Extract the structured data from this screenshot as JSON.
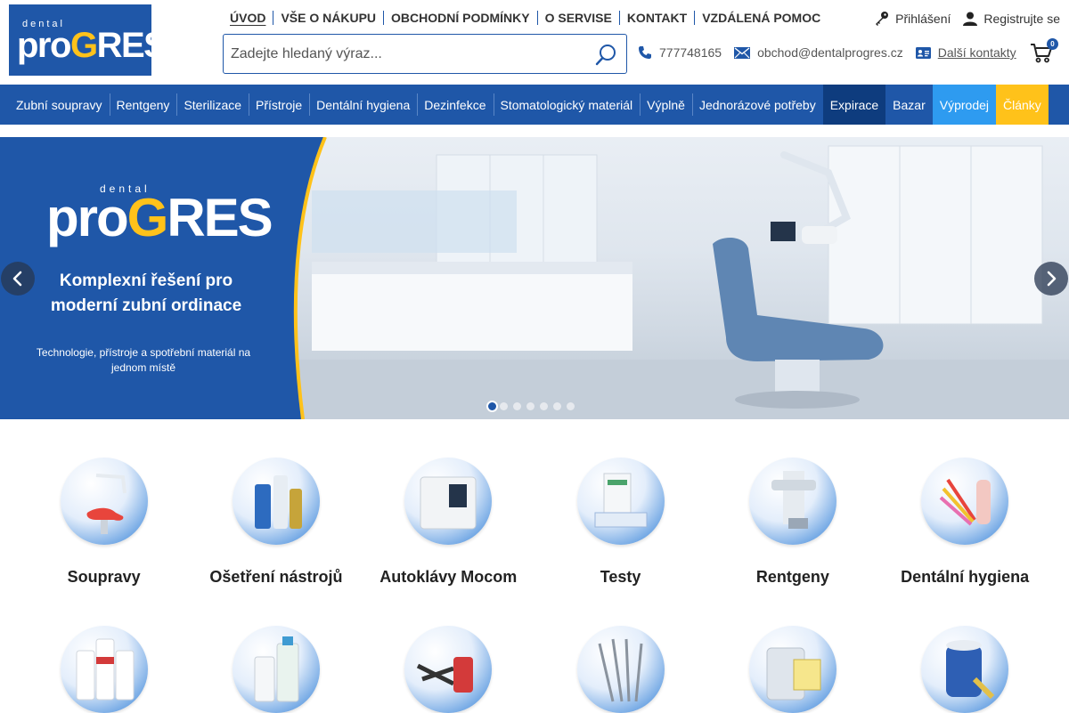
{
  "logo": {
    "small": "dental",
    "pro": "pro",
    "g": "G",
    "res": "RES"
  },
  "topnav": [
    "ÚVOD",
    "VŠE O NÁKUPU",
    "OBCHODNÍ PODMÍNKY",
    "O SERVISE",
    "KONTAKT",
    "VZDÁLENÁ POMOC"
  ],
  "account": {
    "login": "Přihlášení",
    "register": "Registrujte se"
  },
  "search": {
    "placeholder": "Zadejte hledaný výraz..."
  },
  "contacts": {
    "phone": "777748165",
    "email": "obchod@dentalprogres.cz",
    "more": "Další kontakty"
  },
  "cart": {
    "count": "0"
  },
  "categories": [
    "Zubní soupravy",
    "Rentgeny",
    "Sterilizace",
    "Přístroje",
    "Dentální hygiena",
    "Dezinfekce",
    "Stomatologický materiál",
    "Výplně",
    "Jednorázové potřeby",
    "Expirace",
    "Bazar",
    "Výprodej",
    "Články"
  ],
  "hero": {
    "logo_small": "dental",
    "logo_pro": "pro",
    "logo_g": "G",
    "logo_res": "RES",
    "title": "Komplexní řešení pro moderní zubní ordinace",
    "subtitle": "Technologie, přístroje a spotřební materiál na jednom místě",
    "slide_count": 7,
    "active_slide": 1
  },
  "tiles": [
    {
      "name": "Soupravy",
      "icon": "dental-chair-icon"
    },
    {
      "name": "Ošetření nástrojů",
      "icon": "spray-bottles-icon"
    },
    {
      "name": "Autoklávy Mocom",
      "icon": "autoclave-icon"
    },
    {
      "name": "Testy",
      "icon": "test-strips-icon"
    },
    {
      "name": "Rentgeny",
      "icon": "xray-unit-icon"
    },
    {
      "name": "Dentální hygiena",
      "icon": "brushes-icon"
    },
    {
      "name": "",
      "icon": "airflow-powder-icon"
    },
    {
      "name": "",
      "icon": "disinfection-bottles-icon"
    },
    {
      "name": "",
      "icon": "composite-syringes-icon"
    },
    {
      "name": "",
      "icon": "dental-instruments-icon"
    },
    {
      "name": "",
      "icon": "canister-icon"
    },
    {
      "name": "",
      "icon": "wipes-icon"
    }
  ]
}
